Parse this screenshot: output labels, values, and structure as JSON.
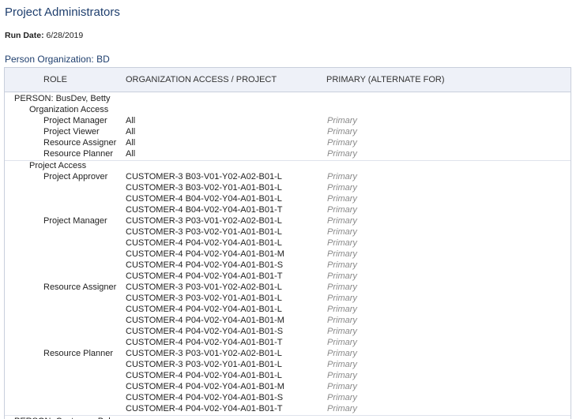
{
  "title": "Project Administrators",
  "run_date_label": "Run Date:",
  "run_date": "6/28/2019",
  "org_label": "Person Organization:",
  "org_value": "BD",
  "columns": {
    "role": "ROLE",
    "access": "ORGANIZATION ACCESS / PROJECT",
    "primary": "PRIMARY (ALTERNATE FOR)"
  },
  "persons": [
    {
      "label": "PERSON:",
      "name": "BusDev, Betty",
      "org_section": "Organization Access",
      "org_access": [
        {
          "role": "Project Manager",
          "access": "All",
          "primary": "Primary"
        },
        {
          "role": "Project Viewer",
          "access": "All",
          "primary": "Primary"
        },
        {
          "role": "Resource Assigner",
          "access": "All",
          "primary": "Primary"
        },
        {
          "role": "Resource Planner",
          "access": "All",
          "primary": "Primary"
        }
      ],
      "proj_section": "Project Access",
      "proj_groups": [
        {
          "role": "Project Approver",
          "items": [
            "CUSTOMER-3 B03-V01-Y02-A02-B01-L",
            "CUSTOMER-3 B03-V02-Y01-A01-B01-L",
            "CUSTOMER-4 B04-V02-Y04-A01-B01-L",
            "CUSTOMER-4 B04-V02-Y04-A01-B01-T"
          ]
        },
        {
          "role": "Project Manager",
          "items": [
            "CUSTOMER-3 P03-V01-Y02-A02-B01-L",
            "CUSTOMER-3 P03-V02-Y01-A01-B01-L",
            "CUSTOMER-4 P04-V02-Y04-A01-B01-L",
            "CUSTOMER-4 P04-V02-Y04-A01-B01-M",
            "CUSTOMER-4 P04-V02-Y04-A01-B01-S",
            "CUSTOMER-4 P04-V02-Y04-A01-B01-T"
          ]
        },
        {
          "role": "Resource Assigner",
          "items": [
            "CUSTOMER-3 P03-V01-Y02-A02-B01-L",
            "CUSTOMER-3 P03-V02-Y01-A01-B01-L",
            "CUSTOMER-4 P04-V02-Y04-A01-B01-L",
            "CUSTOMER-4 P04-V02-Y04-A01-B01-M",
            "CUSTOMER-4 P04-V02-Y04-A01-B01-S",
            "CUSTOMER-4 P04-V02-Y04-A01-B01-T"
          ]
        },
        {
          "role": "Resource Planner",
          "items": [
            "CUSTOMER-3 P03-V01-Y02-A02-B01-L",
            "CUSTOMER-3 P03-V02-Y01-A01-B01-L",
            "CUSTOMER-4 P04-V02-Y04-A01-B01-L",
            "CUSTOMER-4 P04-V02-Y04-A01-B01-M",
            "CUSTOMER-4 P04-V02-Y04-A01-B01-S",
            "CUSTOMER-4 P04-V02-Y04-A01-B01-T"
          ]
        }
      ],
      "primary_text": "Primary"
    },
    {
      "label": "PERSON:",
      "name": "Customer, Bob"
    }
  ]
}
